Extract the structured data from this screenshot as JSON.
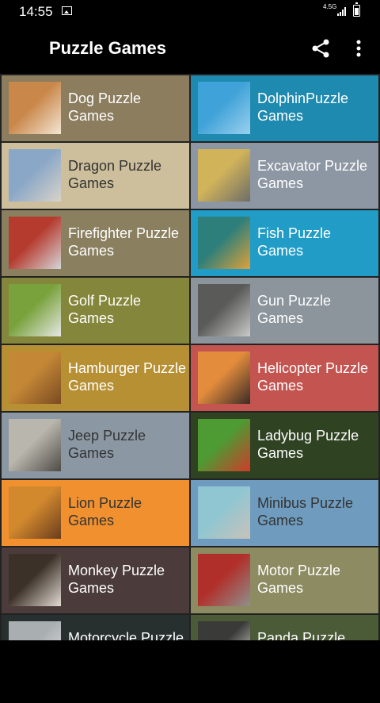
{
  "status": {
    "time": "14:55",
    "network": "4.5G"
  },
  "appbar": {
    "title": "Puzzle Games",
    "share_icon": "share-icon",
    "more_icon": "more-vert-icon"
  },
  "games": [
    {
      "label": "Dog Puzzle Games",
      "bg": "#8b7d5e",
      "text": "#ffffff",
      "thumb": [
        "#c9874a",
        "#f4e6d4"
      ]
    },
    {
      "label": "DolphinPuzzle Games",
      "bg": "#1f8aaf",
      "text": "#ffffff",
      "thumb": [
        "#3fa2d8",
        "#9bd0ee"
      ]
    },
    {
      "label": "Dragon Puzzle Games",
      "bg": "#cdbf9c",
      "text": "#333333",
      "thumb": [
        "#8aa7c8",
        "#d8d3c8"
      ]
    },
    {
      "label": "Excavator Puzzle Games",
      "bg": "#8d97a3",
      "text": "#ffffff",
      "thumb": [
        "#d1b35a",
        "#6c6d67"
      ]
    },
    {
      "label": "Firefighter Puzzle Games",
      "bg": "#8a7f5f",
      "text": "#ffffff",
      "thumb": [
        "#b63b2f",
        "#d5d6d8"
      ]
    },
    {
      "label": "Fish Puzzle Games",
      "bg": "#219cc7",
      "text": "#ffffff",
      "thumb": [
        "#2c7f7b",
        "#e0a138"
      ]
    },
    {
      "label": "Golf Puzzle Games",
      "bg": "#84863c",
      "text": "#ffffff",
      "thumb": [
        "#79a23c",
        "#e6e8e4"
      ]
    },
    {
      "label": "Gun Puzzle Games",
      "bg": "#8c959b",
      "text": "#ffffff",
      "thumb": [
        "#5a5a58",
        "#c9cbc9"
      ]
    },
    {
      "label": "Hamburger Puzzle Games",
      "bg": "#b79034",
      "text": "#ffffff",
      "thumb": [
        "#c48736",
        "#7a4b22"
      ]
    },
    {
      "label": "Helicopter Puzzle Games",
      "bg": "#c35450",
      "text": "#ffffff",
      "thumb": [
        "#e28c3c",
        "#3b2b26"
      ]
    },
    {
      "label": "Jeep Puzzle Games",
      "bg": "#8b98a4",
      "text": "#333333",
      "thumb": [
        "#b9b7ad",
        "#4d4b44"
      ]
    },
    {
      "label": "Ladybug Puzzle Games",
      "bg": "#2f4222",
      "text": "#ffffff",
      "thumb": [
        "#4e9a33",
        "#cf3b2a"
      ]
    },
    {
      "label": "Lion Puzzle Games",
      "bg": "#f0902f",
      "text": "#333333",
      "thumb": [
        "#d2892e",
        "#6b3c1c"
      ]
    },
    {
      "label": "Minibus Puzzle Games",
      "bg": "#6f9cbe",
      "text": "#333333",
      "thumb": [
        "#8fc6d2",
        "#c9c2b9"
      ]
    },
    {
      "label": "Monkey Puzzle Games",
      "bg": "#4b3b3a",
      "text": "#ffffff",
      "thumb": [
        "#3c3129",
        "#e2dcd3"
      ]
    },
    {
      "label": "Motor Puzzle Games",
      "bg": "#8d8b61",
      "text": "#ffffff",
      "thumb": [
        "#b12f2a",
        "#8f8f8d"
      ]
    },
    {
      "label": "Motorcycle Puzzle Games",
      "bg": "#28302f",
      "text": "#ffffff",
      "thumb": [
        "#a9aeb0",
        "#e6e6e6"
      ]
    },
    {
      "label": "Panda Puzzle Games",
      "bg": "#4b5a37",
      "text": "#ffffff",
      "thumb": [
        "#3a3a38",
        "#f4f4f1"
      ]
    }
  ]
}
